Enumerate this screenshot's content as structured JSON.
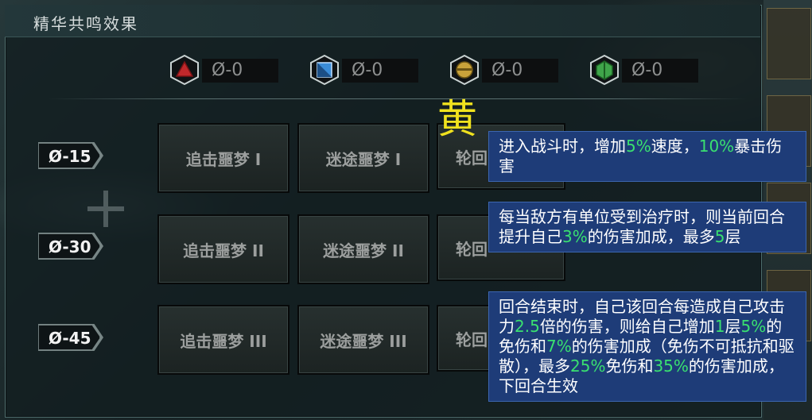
{
  "panel": {
    "title": "精华共鸣效果"
  },
  "counters": [
    {
      "icon": "red-triangle-essence-icon",
      "value": "Ø-0",
      "color": "#c0282b"
    },
    {
      "icon": "blue-square-essence-icon",
      "value": "Ø-0",
      "color": "#3a8cd8"
    },
    {
      "icon": "gold-circle-essence-icon",
      "value": "Ø-0",
      "color": "#c9a23a"
    },
    {
      "icon": "green-diamond-essence-icon",
      "value": "Ø-0",
      "color": "#3fa54a"
    }
  ],
  "tiers": [
    {
      "label": "Ø-15",
      "slots": [
        "追击噩梦 I",
        "迷途噩梦 I",
        "轮回"
      ]
    },
    {
      "label": "Ø-30",
      "slots": [
        "追击噩梦 II",
        "迷途噩梦 II",
        "轮回"
      ]
    },
    {
      "label": "Ø-45",
      "slots": [
        "追击噩梦 III",
        "迷途噩梦 III",
        "轮回"
      ]
    }
  ],
  "annotation": "黄",
  "tooltips": [
    {
      "parts": [
        {
          "t": "进入战斗时，增加",
          "g": false
        },
        {
          "t": "5%",
          "g": true
        },
        {
          "t": "速度，",
          "g": false
        },
        {
          "t": "10%",
          "g": true
        },
        {
          "t": "暴击伤害",
          "g": false
        }
      ]
    },
    {
      "parts": [
        {
          "t": "每当敌方有单位受到治疗时，则当前回合提升自己",
          "g": false
        },
        {
          "t": "3%",
          "g": true
        },
        {
          "t": "的伤害加成，最多",
          "g": false
        },
        {
          "t": "5",
          "g": true
        },
        {
          "t": "层",
          "g": false
        }
      ]
    },
    {
      "parts": [
        {
          "t": "回合结束时，自己该回合每造成自己攻击力",
          "g": false
        },
        {
          "t": "2.5",
          "g": true
        },
        {
          "t": "倍的伤害，则给自己增加",
          "g": false
        },
        {
          "t": "1",
          "g": true
        },
        {
          "t": "层",
          "g": false
        },
        {
          "t": "5%",
          "g": true
        },
        {
          "t": "的免伤和",
          "g": false
        },
        {
          "t": "7%",
          "g": true
        },
        {
          "t": "的伤害加成（免伤不可抵抗和驱散），最多",
          "g": false
        },
        {
          "t": "25%",
          "g": true
        },
        {
          "t": "免伤和",
          "g": false
        },
        {
          "t": "35%",
          "g": true
        },
        {
          "t": "的伤害加成，下回合生效",
          "g": false
        }
      ]
    }
  ],
  "colors": {
    "accent": "#5fd3d0",
    "highlight_green": "#3ae070",
    "tooltip_bg": "#1e3c78",
    "annotation_yellow": "#f0e21e"
  }
}
